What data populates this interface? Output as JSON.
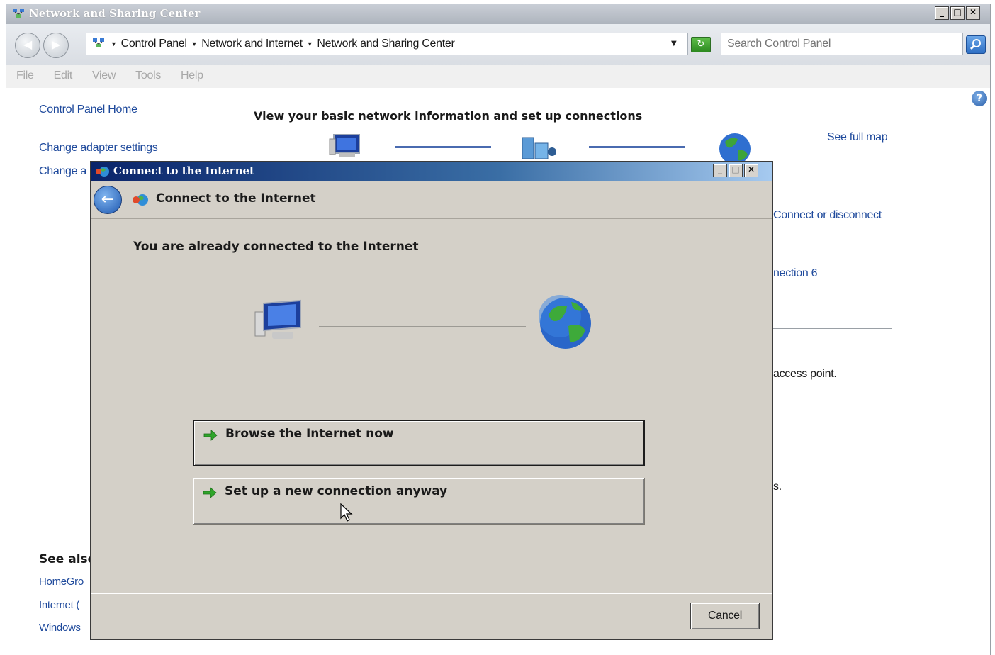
{
  "main_window": {
    "title": "Network and Sharing Center",
    "caption_buttons": [
      "_",
      "□",
      "✕"
    ]
  },
  "address_bar": {
    "crumbs": [
      "Control Panel",
      "Network and Internet",
      "Network and Sharing Center"
    ],
    "search_placeholder": "Search Control Panel"
  },
  "menu": [
    "File",
    "Edit",
    "View",
    "Tools",
    "Help"
  ],
  "sidebar": {
    "home": "Control Panel Home",
    "links": [
      "Change adapter settings",
      "Change a"
    ],
    "see_also_heading": "See also",
    "see_also": [
      "HomeGro",
      "Internet (",
      "Windows"
    ]
  },
  "content": {
    "heading": "View your basic network information and set up connections",
    "see_full_map": "See full map",
    "connect_or_disconnect": "Connect or disconnect",
    "connection_fragment": "nection 6",
    "access_point_fragment": "access point.",
    "fragment_s": "s."
  },
  "dialog": {
    "title": "Connect to the Internet",
    "header_title": "Connect to the Internet",
    "subtitle": "You are already connected to the Internet",
    "options": [
      {
        "label": "Browse the Internet now",
        "mnemonic": "I"
      },
      {
        "label": "Set up a new connection anyway",
        "mnemonic": "S"
      }
    ],
    "cancel_label": "Cancel"
  },
  "icons": {
    "help": "?",
    "back": "←",
    "refresh": "↻"
  }
}
